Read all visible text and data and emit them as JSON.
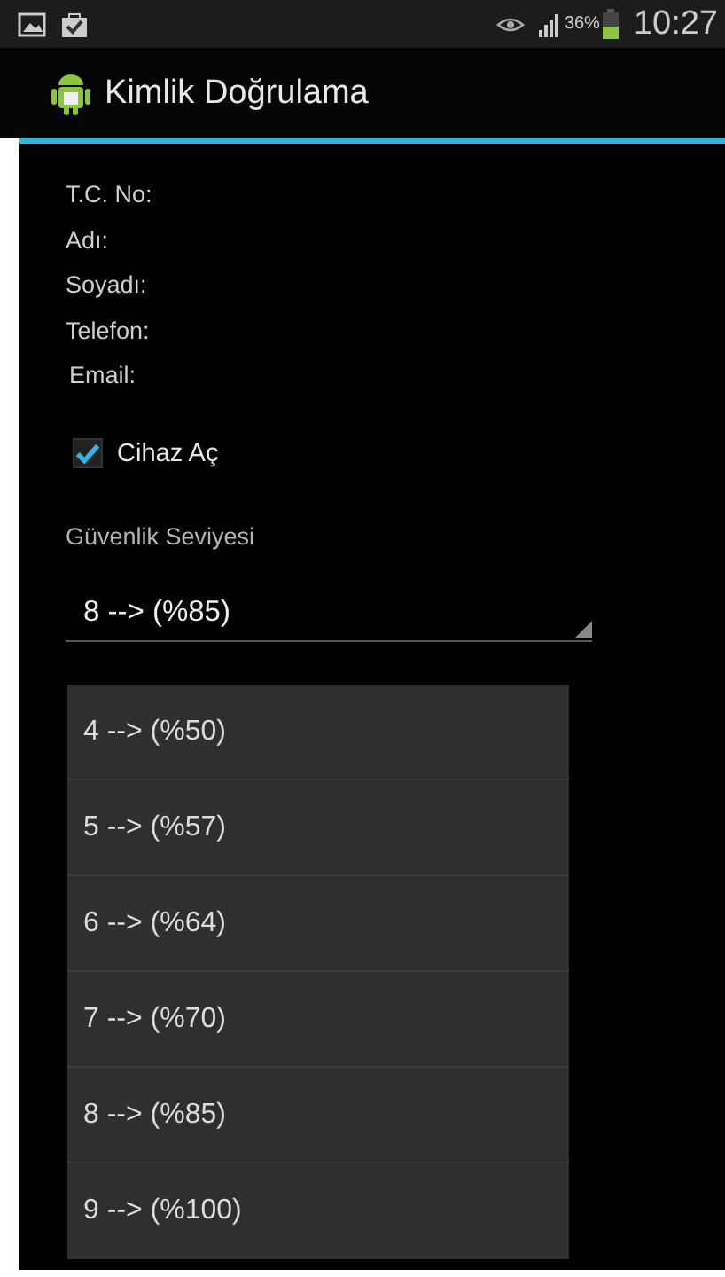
{
  "status_bar": {
    "battery": "36%",
    "time": "10:27"
  },
  "action_bar": {
    "title": "Kimlik Doğrulama"
  },
  "fields": [
    {
      "label": "T.C. No:"
    },
    {
      "label": "Adı:"
    },
    {
      "label": "Soyadı:"
    },
    {
      "label": "Telefon:"
    },
    {
      "label": "Email:"
    }
  ],
  "device_checkbox": {
    "label": "Cihaz Aç",
    "checked": true
  },
  "security_level": {
    "label": "Güvenlik Seviyesi",
    "value": "8 --> (%85)"
  },
  "dropdown": {
    "options": [
      {
        "label": "4 --> (%50)"
      },
      {
        "label": "5 --> (%57)"
      },
      {
        "label": "6 --> (%64)"
      },
      {
        "label": "7 --> (%70)"
      },
      {
        "label": "8 --> (%85)"
      },
      {
        "label": "9 --> (%100)"
      }
    ]
  }
}
